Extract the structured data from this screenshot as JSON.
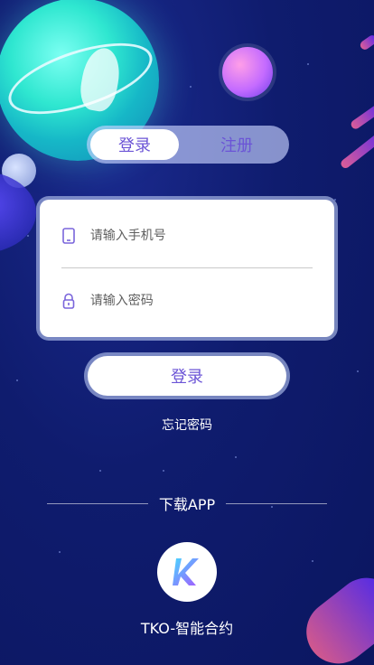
{
  "tabs": {
    "login_label": "登录",
    "register_label": "注册",
    "active": "login"
  },
  "form": {
    "phone_placeholder": "请输入手机号",
    "phone_value": "",
    "password_placeholder": "请输入密码",
    "password_value": "",
    "phone_icon": "phone-icon",
    "password_icon": "lock-icon"
  },
  "actions": {
    "login_button": "登录",
    "forgot_password": "忘记密码"
  },
  "download": {
    "label": "下载APP",
    "app_name": "TKO-智能合约",
    "logo_icon": "k-logo-icon"
  },
  "colors": {
    "accent": "#6B54D6",
    "background": "#0F1C6E",
    "card": "#FFFFFF"
  }
}
